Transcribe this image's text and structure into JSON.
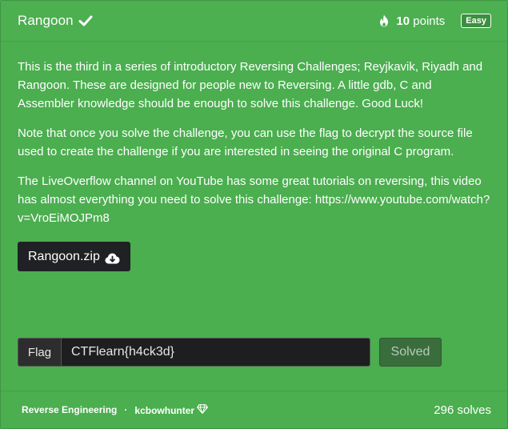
{
  "header": {
    "title": "Rangoon",
    "points_value": "10",
    "points_label": "points",
    "difficulty": "Easy"
  },
  "description": {
    "paragraph1": "This is the third in a series of introductory Reversing Challenges; Reyjkavik, Riyadh and Rangoon. These are designed for people new to Reversing. A little gdb, C and Assembler knowledge should be enough to solve this challenge. Good Luck!",
    "paragraph2": "Note that once you solve the challenge, you can use the flag to decrypt the source file used to create the challenge if you are interested in seeing the original C program.",
    "paragraph3": "The LiveOverflow channel on YouTube has some great tutorials on reversing, this video has almost everything you need to solve this challenge: https://www.youtube.com/watch?v=VroEiMOJPm8"
  },
  "download": {
    "label": "Rangoon.zip"
  },
  "flag": {
    "label": "Flag",
    "value": "CTFlearn{h4ck3d}",
    "submit_label": "Solved"
  },
  "footer": {
    "category": "Reverse Engineering",
    "separator": "·",
    "author": "kcbowhunter",
    "solves": "296 solves"
  },
  "colors": {
    "background": "#4caf50",
    "dark": "#202124"
  },
  "icons": {
    "title_status": "check-icon",
    "points": "flame-icon",
    "download": "cloud-download-icon",
    "author_badge": "gem-icon"
  }
}
